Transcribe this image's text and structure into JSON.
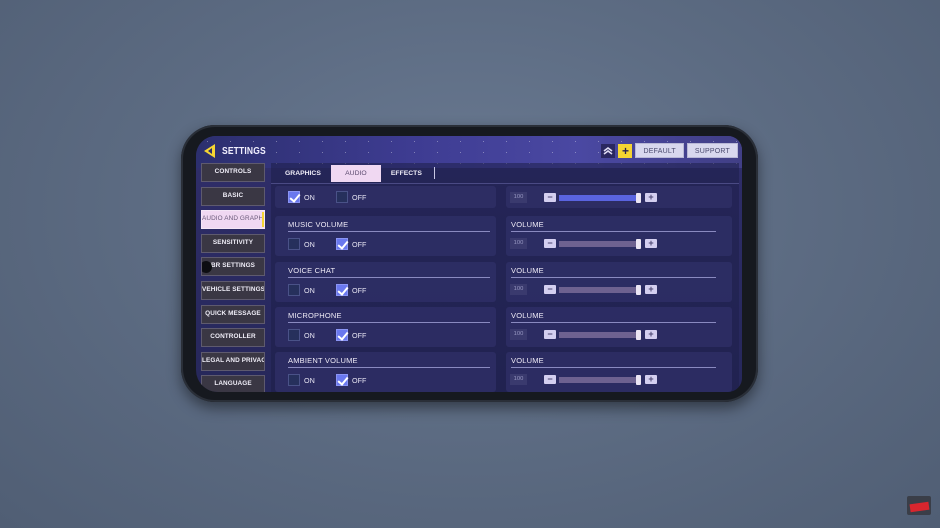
{
  "header": {
    "title": "SETTINGS",
    "back_icon": "back-arrow-icon",
    "rank_icon": "rank-chevrons-icon",
    "plus_label": "+",
    "default_label": "DEFAULT",
    "support_label": "SUPPORT"
  },
  "sidebar": {
    "items": [
      {
        "label": "CONTROLS",
        "active": false
      },
      {
        "label": "BASIC",
        "active": false
      },
      {
        "label": "AUDIO AND GRAPHICS",
        "active": true
      },
      {
        "label": "SENSITIVITY",
        "active": false
      },
      {
        "label": "BR SETTINGS",
        "active": false
      },
      {
        "label": "VEHICLE SETTINGS",
        "active": false
      },
      {
        "label": "QUICK MESSAGE",
        "active": false
      },
      {
        "label": "CONTROLLER",
        "active": false
      },
      {
        "label": "LEGAL AND PRIVACY",
        "active": false
      },
      {
        "label": "LANGUAGE",
        "active": false
      }
    ]
  },
  "tabs": [
    {
      "label": "GRAPHICS",
      "active": false
    },
    {
      "label": "AUDIO",
      "active": true
    },
    {
      "label": "EFFECTS",
      "active": false
    }
  ],
  "audio_settings": [
    {
      "label": "",
      "on_label": "ON",
      "off_label": "OFF",
      "on_checked": true,
      "volume_label": "",
      "volume_value": "100",
      "volume_percent": 100,
      "fill_color": "#5a64e0"
    },
    {
      "label": "MUSIC VOLUME",
      "on_label": "ON",
      "off_label": "OFF",
      "on_checked": false,
      "volume_label": "VOLUME",
      "volume_value": "100",
      "volume_percent": 100,
      "fill_color": "#6e6290"
    },
    {
      "label": "VOICE CHAT",
      "on_label": "ON",
      "off_label": "OFF",
      "on_checked": false,
      "volume_label": "VOLUME",
      "volume_value": "100",
      "volume_percent": 100,
      "fill_color": "#6e6290"
    },
    {
      "label": "MICROPHONE",
      "on_label": "ON",
      "off_label": "OFF",
      "on_checked": false,
      "volume_label": "VOLUME",
      "volume_value": "100",
      "volume_percent": 100,
      "fill_color": "#6e6290"
    },
    {
      "label": "AMBIENT VOLUME",
      "on_label": "ON",
      "off_label": "OFF",
      "on_checked": false,
      "volume_label": "VOLUME",
      "volume_value": "100",
      "volume_percent": 100,
      "fill_color": "#6e6290"
    }
  ],
  "stepper": {
    "minus": "−",
    "plus": "+"
  },
  "colors": {
    "accent_yellow": "#f5d532",
    "active_tab_bg": "#f0d8f2",
    "checkbox_checked": "#6a78ee"
  }
}
